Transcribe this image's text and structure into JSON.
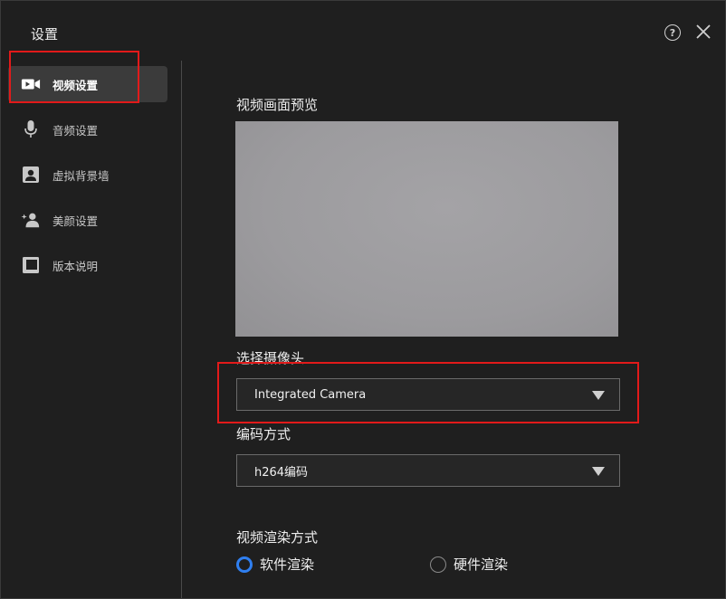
{
  "window": {
    "title": "设置"
  },
  "header": {
    "help_icon": "help-circle-icon",
    "close_icon": "close-icon"
  },
  "sidebar": {
    "items": [
      {
        "label": "视频设置",
        "icon": "video-camera-icon",
        "active": true
      },
      {
        "label": "音频设置",
        "icon": "microphone-icon",
        "active": false
      },
      {
        "label": "虚拟背景墙",
        "icon": "portrait-icon",
        "active": false
      },
      {
        "label": "美颜设置",
        "icon": "beauty-person-icon",
        "active": false
      },
      {
        "label": "版本说明",
        "icon": "document-icon",
        "active": false
      }
    ]
  },
  "main": {
    "preview_label": "视频画面预览",
    "camera_label": "选择摄像头",
    "camera_value": "Integrated Camera",
    "encoding_label": "编码方式",
    "encoding_value": "h264编码",
    "render_label": "视频渲染方式",
    "render_options": [
      {
        "label": "软件渲染",
        "checked": true
      },
      {
        "label": "硬件渲染",
        "checked": false
      }
    ]
  },
  "colors": {
    "accent": "#2f7ff0",
    "highlight": "#e21a1a",
    "background": "#1f1f1f"
  }
}
